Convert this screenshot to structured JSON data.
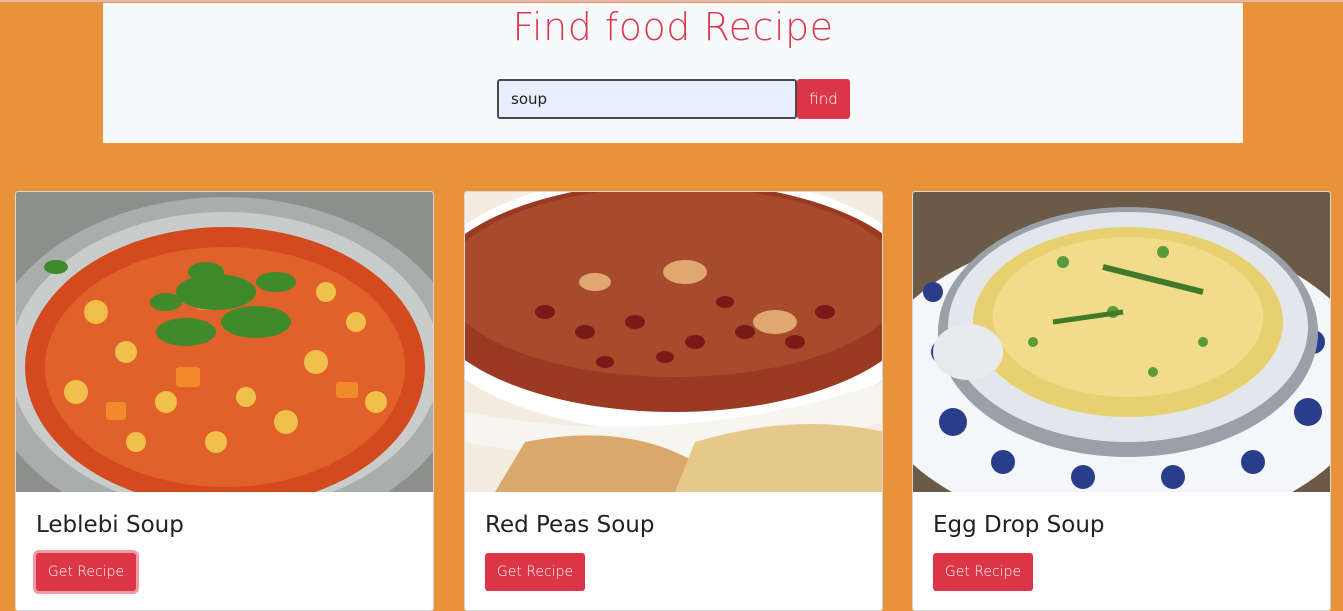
{
  "header": {
    "title": "Find food Recipe"
  },
  "search": {
    "value": "soup",
    "button_label": "find"
  },
  "recipes": [
    {
      "name": "Leblebi Soup",
      "button_label": "Get Recipe",
      "image": "leblebi-soup-photo"
    },
    {
      "name": "Red Peas Soup",
      "button_label": "Get Recipe",
      "image": "red-peas-soup-photo"
    },
    {
      "name": "Egg Drop Soup",
      "button_label": "Get Recipe",
      "image": "egg-drop-soup-photo"
    }
  ],
  "colors": {
    "page_background": "#e8923a",
    "header_background": "#f8f9fb",
    "accent": "#dc3545",
    "title": "#d93a4e"
  }
}
